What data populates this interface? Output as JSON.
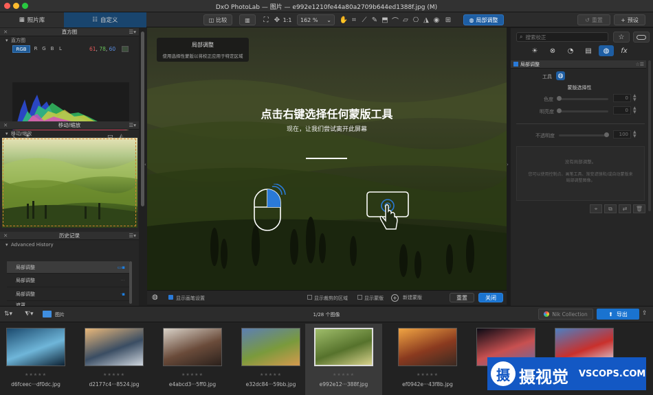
{
  "window": {
    "title": "DxO PhotoLab — 图片 — e992e1210fe44a80a2709b644ed1388f.jpg (M)"
  },
  "tabs": {
    "library": "照片库",
    "customize": "自定义"
  },
  "toolbar": {
    "compare": "比较",
    "zoom_fit": "1:1",
    "zoom_level": "162 %",
    "local_adjust": "局部调整",
    "reset": "重置",
    "preset": "预设"
  },
  "histogram": {
    "title": "直方图",
    "section": "直方图",
    "channels": [
      "RGB",
      "R",
      "G",
      "B",
      "L"
    ],
    "rgb_values": [
      "61",
      "78",
      "60"
    ]
  },
  "navigator": {
    "title": "移动/缩放",
    "section": "移动/缩放"
  },
  "history": {
    "title": "历史记录",
    "section": "Advanced History",
    "items": [
      "局部调整",
      "局部调整",
      "局部调整",
      "遮罩"
    ]
  },
  "viewer": {
    "tooltip_title": "局部调整",
    "tooltip_text": "使用选择性蒙版以将校正应用于特定区域",
    "heading": "点击右键选择任何蒙版工具",
    "subheading": "现在，让我们尝试离开此屏幕"
  },
  "viewer_bottom": {
    "show_brush": "显示画笔设置",
    "show_crop": "显示裁剪的区域",
    "show_mask": "显示蒙版",
    "new_mask": "新建蒙版",
    "reset": "重置",
    "close": "关闭"
  },
  "right_panel": {
    "search_placeholder": "搜索校正",
    "section_title": "局部调整",
    "tool_label": "工具",
    "mask_selector": "蒙版选择性",
    "chroma_label": "色度",
    "chroma_value": "0",
    "luma_label": "明亮度",
    "luma_value": "0",
    "opacity_label": "不透明度",
    "opacity_value": "100",
    "empty_title": "没有局部调整。",
    "empty_text": "您可以使用控制点、画笔工具、渐变滤镜和/或自动蒙版来局部调整图像。"
  },
  "filmstrip_bar": {
    "folder": "图片",
    "count": "1/28 个图像",
    "nik": "Nik Collection",
    "export": "导出"
  },
  "filmstrip": [
    {
      "name": "d6fceec···df0dc.jpg",
      "colors": [
        "#1b4a6e",
        "#6fb6d9",
        "#0d2234"
      ]
    },
    {
      "name": "d2177c4···8524.jpg",
      "colors": [
        "#e9b87a",
        "#3a4d63",
        "#cfd6de"
      ]
    },
    {
      "name": "e4abcd3···5ff0.jpg",
      "colors": [
        "#d9d2c8",
        "#6a4b3a",
        "#2b211c"
      ]
    },
    {
      "name": "e32dc84···59bb.jpg",
      "colors": [
        "#5c7fb4",
        "#7a9a3c",
        "#d59a4e"
      ]
    },
    {
      "name": "e992e12···388f.jpg",
      "colors": [
        "#9fbd6a",
        "#56722c",
        "#d8d28c"
      ]
    },
    {
      "name": "ef0942e···43f8b.jpg",
      "colors": [
        "#f1a543",
        "#8a3a1f",
        "#3a2a22"
      ]
    },
    {
      "name": "",
      "colors": [
        "#0a0a14",
        "#c85050",
        "#6a6aa0"
      ]
    },
    {
      "name": "",
      "colors": [
        "#4c7fc2",
        "#c9302c",
        "#d8e2f0"
      ]
    }
  ],
  "watermark": {
    "cn": "摄视觉",
    "en": "VSCOPS.COM"
  },
  "colors": {
    "accent": "#1e6fc4",
    "active_tab": "#19456e",
    "close_btn": "#1a73d0"
  }
}
